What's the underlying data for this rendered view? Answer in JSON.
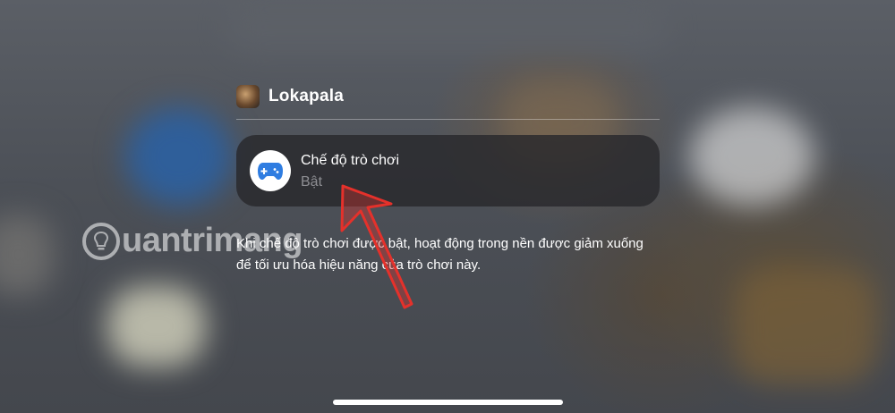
{
  "header": {
    "app_name": "Lokapala"
  },
  "game_mode": {
    "title": "Chế độ trò chơi",
    "status": "Bật",
    "icon": "game-controller-icon"
  },
  "description": "Khi chế độ trò chơi được bật, hoạt động trong nền được giảm xuống để tối ưu hóa hiệu năng của trò chơi này.",
  "watermark": {
    "text": "uantrimang"
  },
  "colors": {
    "accent_blue": "#2f7de1",
    "arrow_red": "#e4312b",
    "card_bg": "#28282c"
  }
}
